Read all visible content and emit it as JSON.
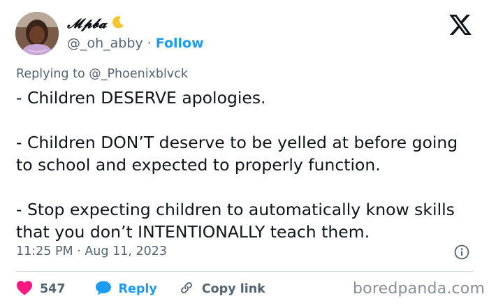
{
  "author": {
    "display_name": "𝓜𝓹𝓫𝓪",
    "handle": "@_oh_abby",
    "separator": "·",
    "follow_label": "Follow"
  },
  "reply_context": {
    "prefix": "Replying to",
    "mention": "@_Phoenixblvck"
  },
  "tweet": {
    "paragraphs": [
      "- Children DESERVE apologies.",
      "- Children DON’T deserve to be yelled at before going to school and expected to properly function.",
      "- Stop expecting children to automatically know skills that you don’t INTENTIONALLY teach them."
    ],
    "timestamp": "11:25 PM · Aug 11, 2023"
  },
  "actions": {
    "like_count": "547",
    "reply_label": "Reply",
    "copy_link_label": "Copy link"
  },
  "watermark": "boredpanda.com",
  "colors": {
    "accent": "#1d9bf0",
    "like": "#f91880",
    "secondary_text": "#536471",
    "moon": "#f4c430"
  },
  "icons": {
    "platform": "x-logo-icon",
    "moon": "crescent-moon-icon",
    "info": "info-icon",
    "heart": "heart-icon",
    "reply": "reply-bubble-icon",
    "link": "link-icon"
  }
}
